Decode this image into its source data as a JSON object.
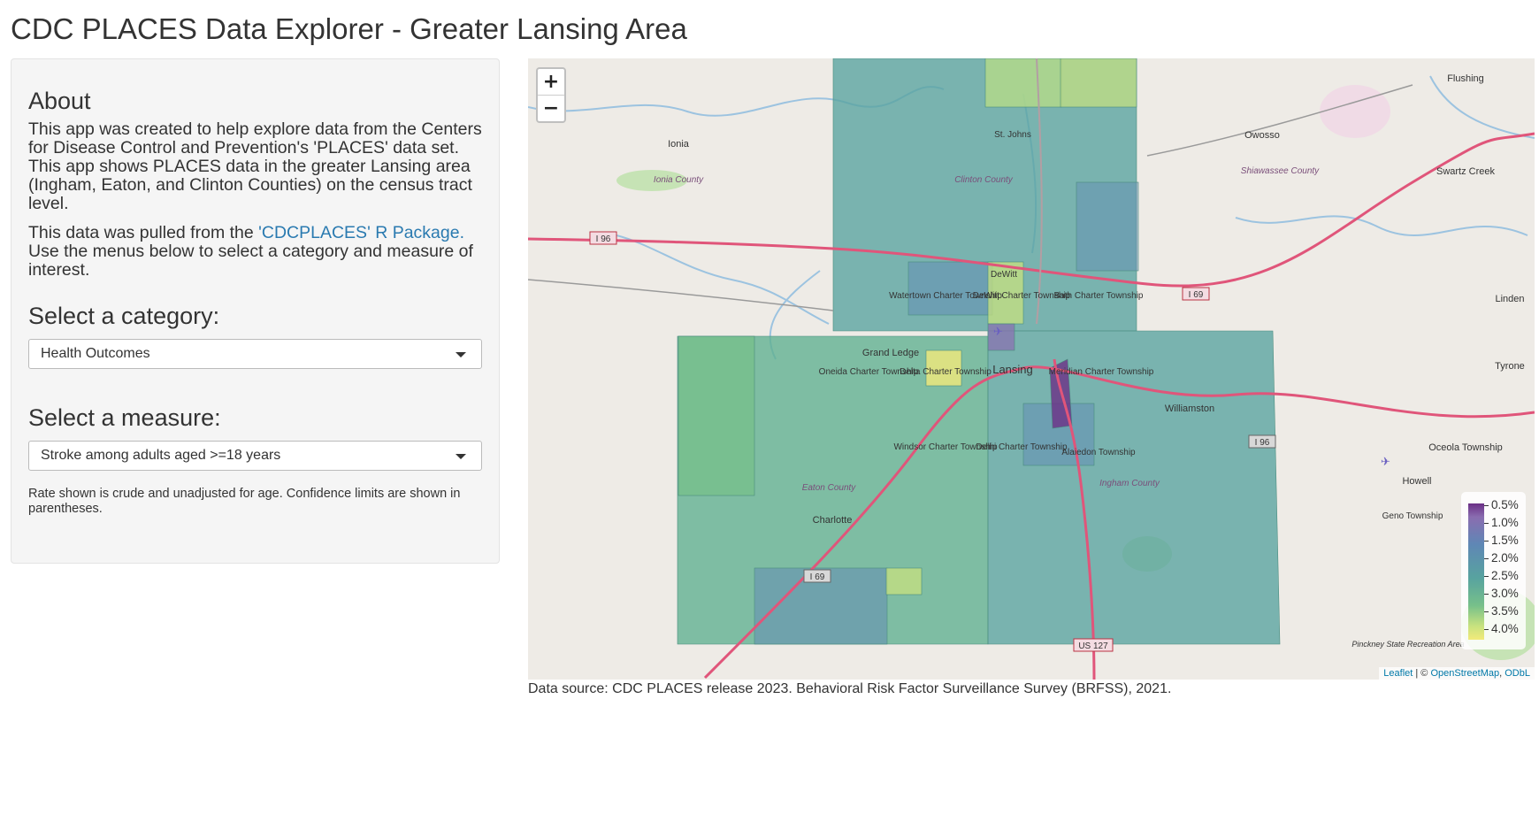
{
  "page": {
    "title": "CDC PLACES Data Explorer - Greater Lansing Area"
  },
  "sidebar": {
    "about_heading": "About",
    "about_text": "This app was created to help explore data from the Centers for Disease Control and Prevention's 'PLACES' data set. This app shows PLACES data in the greater Lansing area (Ingham, Eaton, and Clinton Counties) on the census tract level.",
    "source_prefix": "This data was pulled from the ",
    "source_link": "'CDCPLACES' R Package.",
    "source_suffix": " Use the menus below to select a category and measure of interest.",
    "category_label": "Select a category:",
    "category_value": "Health Outcomes",
    "measure_label": "Select a measure:",
    "measure_value": "Stroke among adults aged >=18 years",
    "note": "Rate shown is crude and unadjusted for age. Confidence limits are shown in parentheses."
  },
  "map": {
    "zoom_in": "+",
    "zoom_out": "−",
    "legend": [
      "0.5%",
      "1.0%",
      "1.5%",
      "2.0%",
      "2.5%",
      "3.0%",
      "3.5%",
      "4.0%"
    ],
    "attribution": {
      "leaflet": "Leaflet",
      "sep": " | © ",
      "osm": "OpenStreetMap",
      "odbl": "ODbL"
    },
    "places": [
      "Ionia",
      "Owosso",
      "Flushing",
      "St. Johns",
      "DeWitt",
      "Lansing",
      "Grand Ledge",
      "Charlotte",
      "Williamston",
      "Swartz Creek",
      "Linden",
      "Tyrone",
      "Howell",
      "Oceola Township",
      "Watertown Charter Township",
      "DeWitt Charter Township",
      "Bath Charter Township",
      "Oneida Charter Township",
      "Delta Charter Township",
      "Meridian Charter Township",
      "Windsor Charter Township",
      "Delhi Charter Township",
      "Alaiedon Township",
      "Geno Township",
      "Pinckney State Recreation Area"
    ],
    "counties": [
      "Ionia County",
      "Clinton County",
      "Shiawassee County",
      "Eaton County",
      "Ingham County"
    ],
    "roads": [
      "I 96",
      "I 69",
      "US 127"
    ]
  },
  "footer": {
    "data_source": "Data source: CDC PLACES release 2023. Behavioral Risk Factor Surveillance Survey (BRFSS), 2021."
  },
  "colors": {
    "link": "#2a7ab0",
    "tract_low": "#f2ea7a",
    "tract_mid": "#58a39f",
    "tract_high": "#6b2f86"
  }
}
